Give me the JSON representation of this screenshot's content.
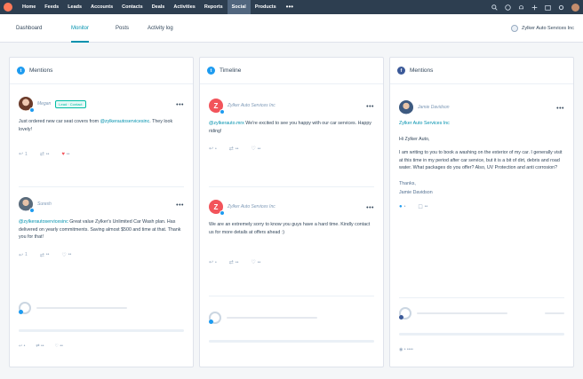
{
  "topnav": {
    "items": [
      "Home",
      "Feeds",
      "Leads",
      "Accounts",
      "Contacts",
      "Deals",
      "Activities",
      "Reports",
      "Social",
      "Products"
    ],
    "active_index": 8,
    "more_label": "•••",
    "right_icons": [
      "search-icon",
      "help-icon",
      "notification-icon",
      "add-icon",
      "calendar-icon",
      "settings-icon"
    ]
  },
  "subnav": {
    "tabs": [
      "Dashboard",
      "Monitor",
      "Posts",
      "Activity log"
    ],
    "active_index": 1,
    "account_label": "Zylker Auto Services Inc"
  },
  "columns": [
    {
      "title": "Mentions",
      "icon_color": "#1d9bf0",
      "icon_glyph": "t",
      "posts": [
        {
          "author": "Megan",
          "badge": "Lead · Contact",
          "text_before": "Just ordered new car seat covers from ",
          "mention": "@zylkerautoservicesinc",
          "text_after": ". They look lovely!",
          "actions": [
            {
              "icon": "reply-icon",
              "label": "1"
            },
            {
              "icon": "retweet-icon",
              "label": "••"
            },
            {
              "icon": "like-icon",
              "label": "••"
            }
          ]
        },
        {
          "author": "Suresh",
          "badge": "",
          "text_before": "",
          "mention": "@zylkerautoservicesinc",
          "text_after": " Great value Zylker's Unlimited Car Wash plan. Has delivered on yearly commitments. Saving almost $500 and time at that. Thank you for that!",
          "actions": [
            {
              "icon": "reply-icon",
              "label": "1"
            },
            {
              "icon": "retweet-icon",
              "label": "••"
            },
            {
              "icon": "like-icon",
              "label": "••"
            }
          ]
        }
      ],
      "footer_actions": [
        "•",
        "••",
        "••"
      ]
    },
    {
      "title": "Timeline",
      "icon_color": "#1d9bf0",
      "icon_glyph": "t",
      "posts": [
        {
          "author": "Zylker Auto Services Inc",
          "badge": "",
          "text_before": "",
          "mention": "@zylkerauto.mrx",
          "text_after": " We're excited to see you happy with our car services. Happy riding!",
          "actions": [
            {
              "icon": "reply-icon",
              "label": "•"
            },
            {
              "icon": "retweet-icon",
              "label": "••"
            },
            {
              "icon": "like-icon",
              "label": "••"
            }
          ]
        },
        {
          "author": "Zylker Auto Services Inc",
          "badge": "",
          "text_before": "We are an extremely sorry to know you guys have a hard time. Kindly contact us for more details at offers ahead :)",
          "mention": "",
          "text_after": "",
          "actions": [
            {
              "icon": "reply-icon",
              "label": "•"
            },
            {
              "icon": "retweet-icon",
              "label": "••"
            },
            {
              "icon": "like-icon",
              "label": "••"
            }
          ]
        }
      ]
    },
    {
      "title": "Mentions",
      "icon_color": "#3b5998",
      "icon_glyph": "f",
      "posts": [
        {
          "author": "Jamie Davidson",
          "badge": "",
          "mention_line": "Zylker Auto Services Inc",
          "greeting": "Hi Zylker Auto,",
          "text": "I am writing to you to book a washing on the exterior of my car. I generally visit at this time in my period after car service, but it is a bit of dirt, debris and road water. What packages do you offer? Also, UV Protection and anti corrosion?",
          "sign_off": "Thanks,",
          "signature": "Jamie Davidson",
          "actions": [
            {
              "icon": "like-icon",
              "label": "•"
            },
            {
              "icon": "comment-icon",
              "label": "••"
            }
          ]
        }
      ],
      "footer_actions": [
        "• ••••"
      ]
    }
  ]
}
